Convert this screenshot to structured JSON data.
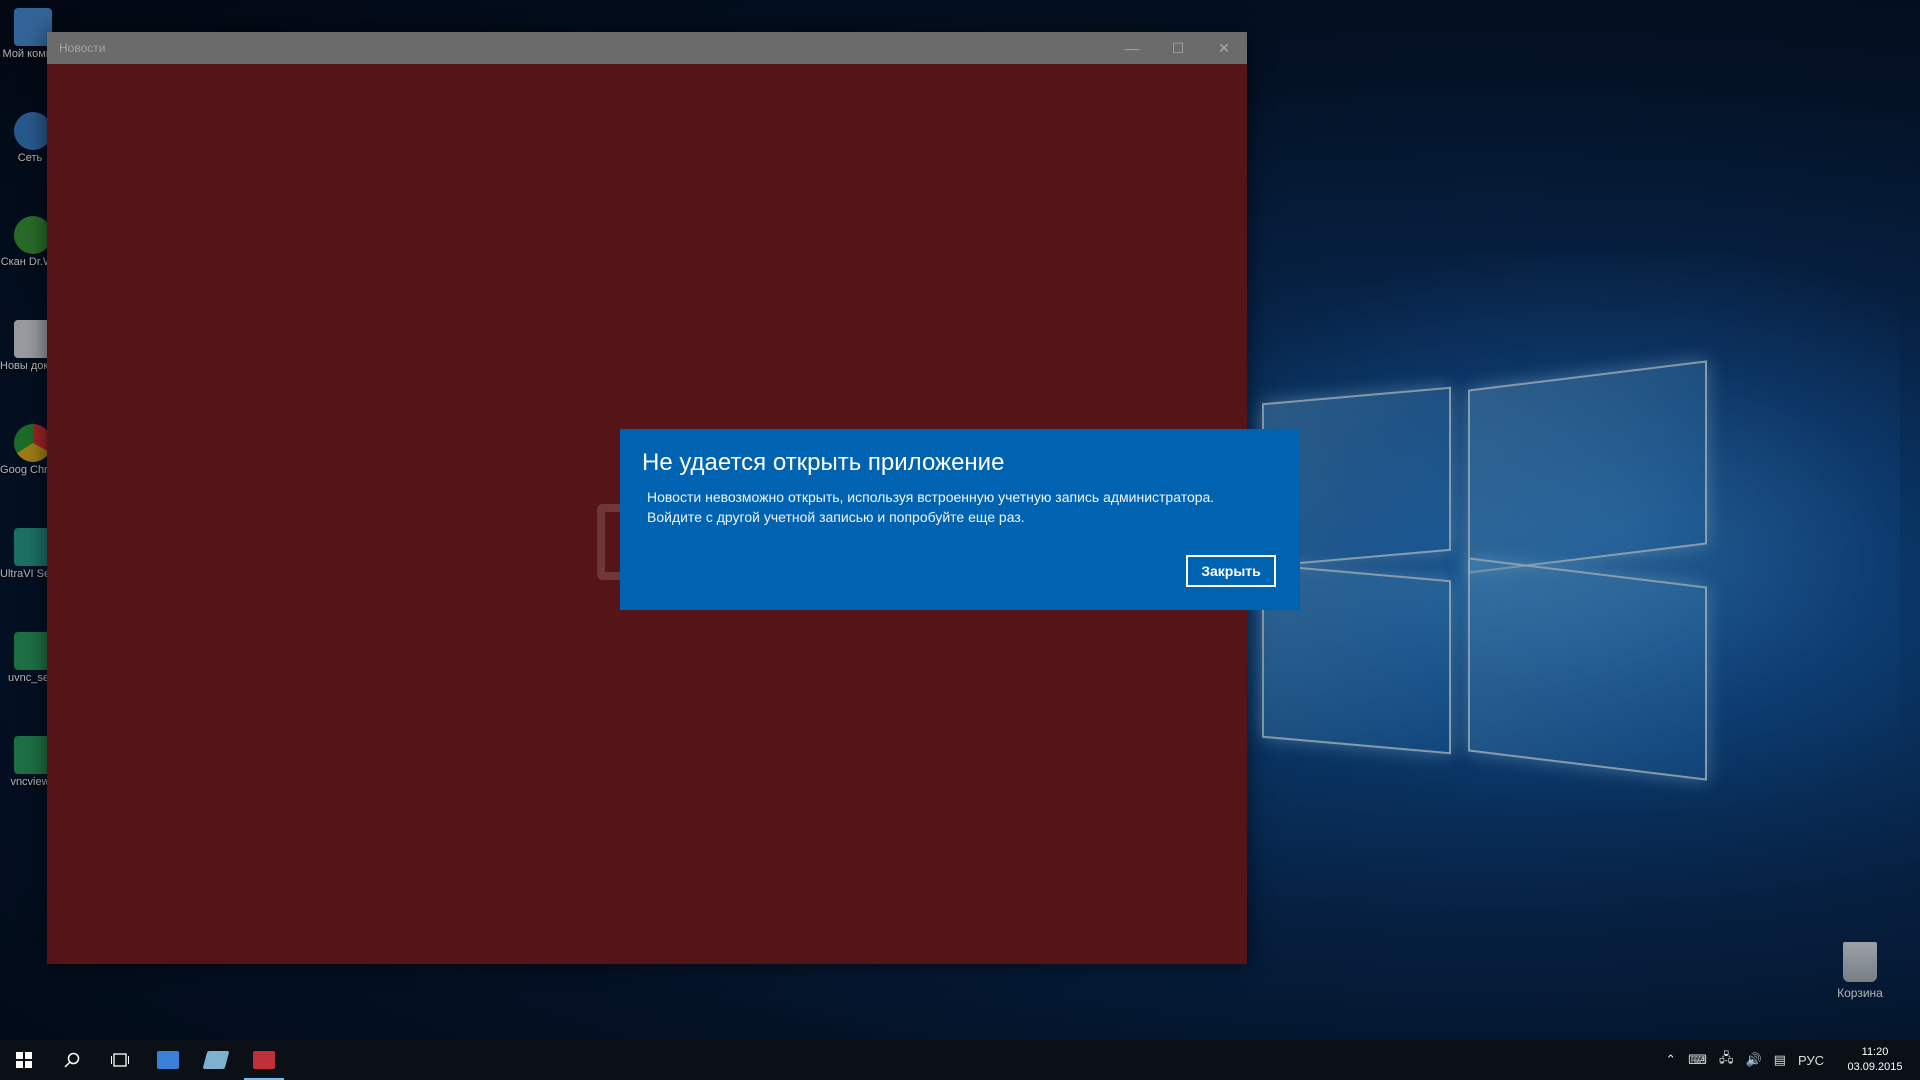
{
  "desktop": {
    "icons": [
      {
        "label": "Мой компь",
        "icon": "computer-icon",
        "color": "#4a8fd8"
      },
      {
        "label": "Сеть",
        "icon": "network-icon",
        "color": "#3a7fc8"
      },
      {
        "label": "Скан Dr.We",
        "icon": "drweb-icon",
        "color": "#3a9a3a"
      },
      {
        "label": "Новы докумен",
        "icon": "document-icon",
        "color": "#d8dde4"
      },
      {
        "label": "Goog Chron",
        "icon": "chrome-icon",
        "color": "#e0b020"
      },
      {
        "label": "UltraVI Serve",
        "icon": "ultravnc-icon",
        "color": "#2aa090"
      },
      {
        "label": "uvnc_set",
        "icon": "uvnc-settings-icon",
        "color": "#2aa060"
      },
      {
        "label": "vncview",
        "icon": "vncviewer-icon",
        "color": "#2aa060"
      }
    ],
    "recycle_bin_label": "Корзина"
  },
  "window": {
    "title": "Новости",
    "background": "#7a1d21",
    "controls": {
      "minimize": "—",
      "maximize": "☐",
      "close": "✕"
    }
  },
  "dialog": {
    "title": "Не удается открыть приложение",
    "message_line1": "Новости невозможно открыть, используя встроенную учетную запись администратора.",
    "message_line2": "Войдите с другой учетной записью и попробуйте еще раз.",
    "close_button": "Закрыть",
    "background": "#0063b1"
  },
  "taskbar": {
    "start_icon": "windows-start-icon",
    "search_icon": "search-icon",
    "task_view_icon": "task-view-icon",
    "pinned": [
      {
        "name": "explorer-app-icon",
        "color": "#3a7fd8"
      },
      {
        "name": "store-app-icon",
        "color": "#7fb0d0"
      },
      {
        "name": "news-app-icon",
        "color": "#c0303a"
      }
    ],
    "tray": {
      "language": "РУС",
      "time": "11:20",
      "date": "03.09.2015"
    }
  }
}
